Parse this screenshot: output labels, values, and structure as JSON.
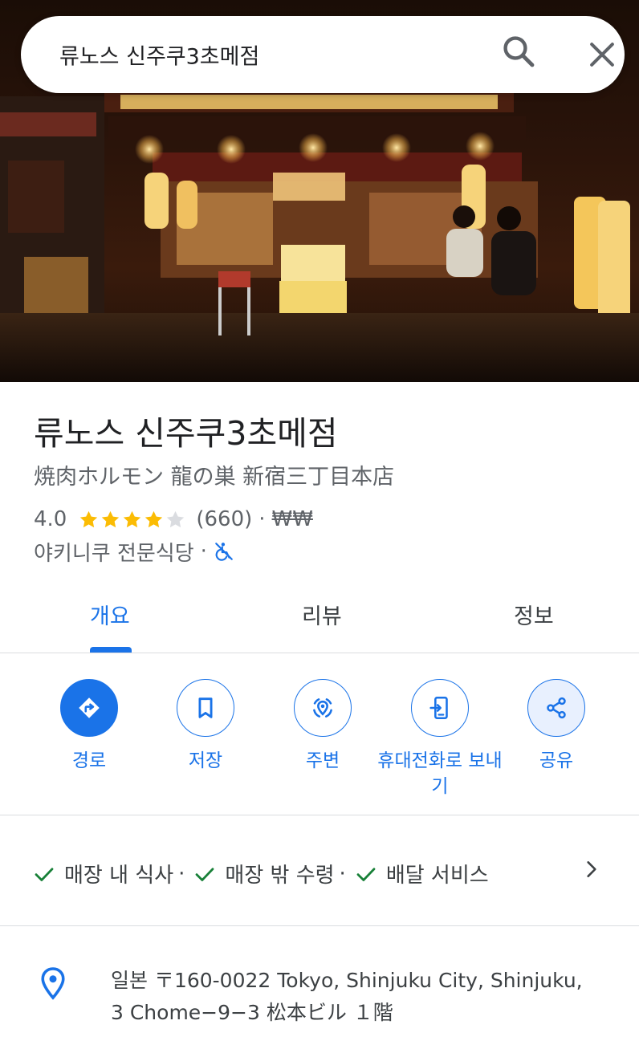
{
  "search": {
    "query": "류노스 신주쿠3초메점"
  },
  "place": {
    "title": "류노스 신주쿠3초메점",
    "subtitle": "焼肉ホルモン 龍の巣 新宿三丁目本店",
    "rating": "4.0",
    "rating_value": 4,
    "rating_max": 5,
    "review_count": "(660)",
    "separator": "·",
    "price_level": "₩₩",
    "category": "야키니쿠 전문식당",
    "category_separator": "·"
  },
  "tabs": [
    {
      "label": "개요",
      "active": true
    },
    {
      "label": "리뷰",
      "active": false
    },
    {
      "label": "정보",
      "active": false
    }
  ],
  "actions": [
    {
      "label": "경로",
      "icon": "directions-icon"
    },
    {
      "label": "저장",
      "icon": "bookmark-icon"
    },
    {
      "label": "주변",
      "icon": "nearby-icon"
    },
    {
      "label": "휴대전화로 보내기",
      "icon": "send-to-phone-icon"
    },
    {
      "label": "공유",
      "icon": "share-icon"
    }
  ],
  "services": {
    "items": [
      "매장 내 식사",
      "매장 밖 수령",
      "배달 서비스"
    ],
    "separator": "·"
  },
  "address": {
    "line1": "일본 〒160-0022 Tokyo, Shinjuku City, Shinjuku,",
    "line2": "3 Chome−9−3 松本ビル １階"
  },
  "colors": {
    "accent": "#1a73e8",
    "star": "#fbbc04",
    "star_empty": "#dadce0",
    "check": "#188038",
    "text_secondary": "#5f6368"
  }
}
